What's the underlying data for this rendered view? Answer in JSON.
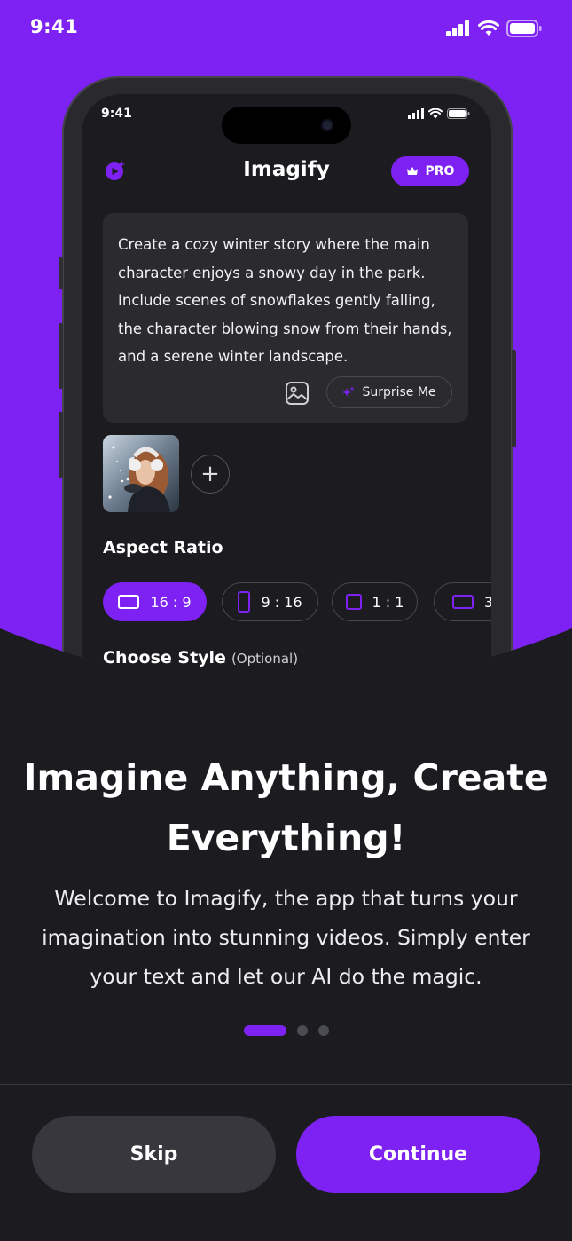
{
  "status_bar": {
    "time": "9:41"
  },
  "phone": {
    "status_time": "9:41",
    "app_title": "Imagify",
    "pro_label": "PRO",
    "prompt_text": "Create a cozy winter story where the main character enjoys a snowy day in the park. Include scenes of snowflakes gently falling, the character blowing snow from their hands, and a serene winter landscape.",
    "surprise_label": "Surprise Me",
    "add_symbol": "+",
    "aspect_ratio_title": "Aspect Ratio",
    "ratios": [
      "16 : 9",
      "9 : 16",
      "1 : 1",
      "3"
    ],
    "selected_ratio": "16 : 9",
    "choose_style_title": "Choose Style",
    "optional_label": "(Optional)"
  },
  "onboarding": {
    "headline_line1": "Imagine Anything, Create",
    "headline_line2": "Everything!",
    "body_line1": "Welcome to Imagify, the app that turns your",
    "body_line2": "imagination into stunning videos. Simply enter",
    "body_line3": "your text and let our AI do the magic.",
    "page_index": 1,
    "page_count": 3
  },
  "buttons": {
    "skip": "Skip",
    "continue": "Continue"
  },
  "colors": {
    "accent": "#7d22f2",
    "background": "#1c1c20",
    "card": "#2a2a2f",
    "secondary_button": "#37373d"
  },
  "icons": [
    "cellular-signal-icon",
    "wifi-icon",
    "battery-icon",
    "app-logo-icon",
    "crown-icon",
    "image-icon",
    "sparkle-icon",
    "plus-icon",
    "landscape-ratio-icon",
    "portrait-ratio-icon",
    "square-ratio-icon"
  ]
}
